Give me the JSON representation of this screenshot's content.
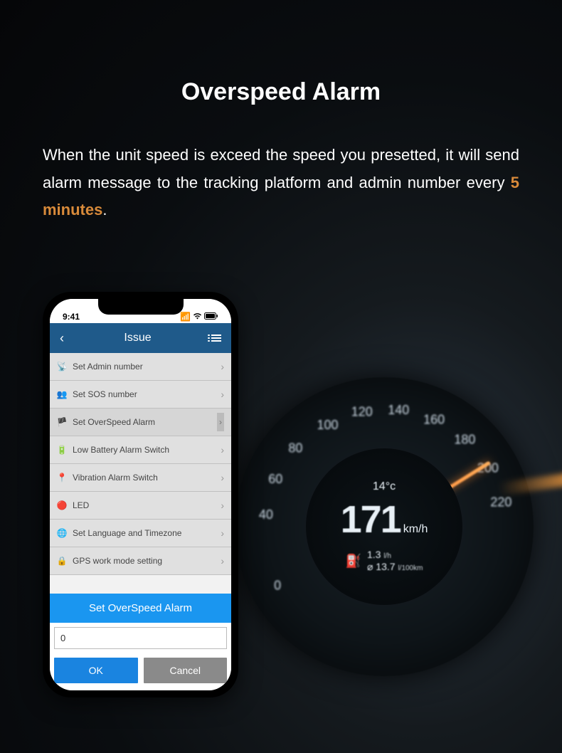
{
  "page": {
    "title": "Overspeed Alarm",
    "desc_pre": "When the unit speed is exceed the speed you presetted, it will send alarm message to the tracking platform and admin number every ",
    "desc_highlight": "5 minutes",
    "desc_post": "."
  },
  "phone": {
    "status_time": "9:41",
    "nav_title": "Issue",
    "list": [
      {
        "icon": "📡",
        "label": "Set Admin number"
      },
      {
        "icon": "👥",
        "label": "Set SOS number"
      },
      {
        "icon": "🏴",
        "label": "Set OverSpeed Alarm",
        "selected": true
      },
      {
        "icon": "🔋",
        "label": "Low Battery Alarm Switch"
      },
      {
        "icon": "📍",
        "label": "Vibration Alarm Switch"
      },
      {
        "icon": "🔴",
        "label": "LED"
      },
      {
        "icon": "🌐",
        "label": "Set Language and Timezone"
      },
      {
        "icon": "🔒",
        "label": "GPS work mode setting"
      }
    ],
    "modal": {
      "title": "Set OverSpeed Alarm",
      "input_value": "0",
      "ok": "OK",
      "cancel": "Cancel"
    }
  },
  "speedo": {
    "ticks": [
      {
        "v": "0",
        "ang": 150
      },
      {
        "v": "40",
        "ang": 186
      },
      {
        "v": "60",
        "ang": 204
      },
      {
        "v": "80",
        "ang": 222
      },
      {
        "v": "100",
        "ang": 240
      },
      {
        "v": "120",
        "ang": 258
      },
      {
        "v": "140",
        "ang": 276
      },
      {
        "v": "160",
        "ang": 294
      },
      {
        "v": "180",
        "ang": 312
      },
      {
        "v": "200",
        "ang": 330
      },
      {
        "v": "220",
        "ang": 348
      }
    ],
    "temp": "14°c",
    "speed": "171",
    "speed_unit": "km/h",
    "fuel_top": "1.3",
    "fuel_top_unit": "l/h",
    "fuel_bottom": "13.7",
    "fuel_bottom_unit": "l/100km"
  }
}
